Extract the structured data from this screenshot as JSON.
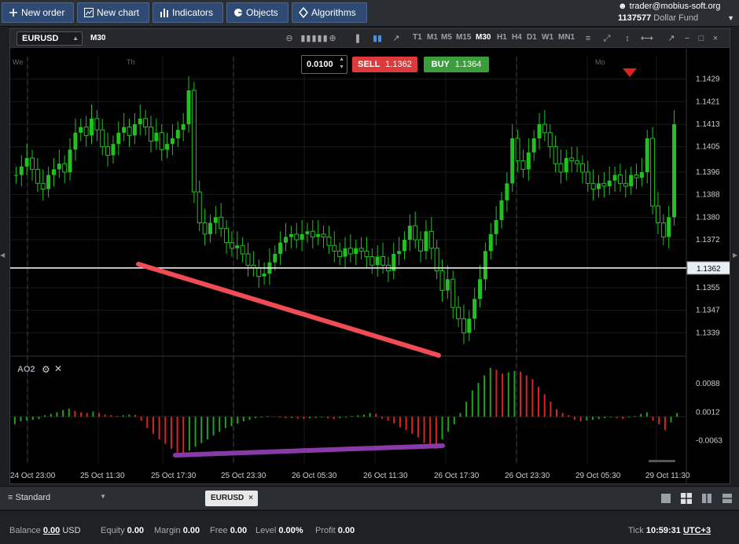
{
  "toolbar": {
    "new_order": "New order",
    "new_chart": "New chart",
    "indicators": "Indicators",
    "objects": "Objects",
    "algorithms": "Algorithms"
  },
  "account": {
    "user": "trader@mobius-soft.org",
    "number": "1137577",
    "fund": "Dollar Fund"
  },
  "chart_header": {
    "symbol": "EURUSD",
    "timeframe": "M30",
    "timeframes": [
      "T1",
      "M1",
      "M5",
      "M15",
      "M30",
      "H1",
      "H4",
      "D1",
      "W1",
      "MN1"
    ],
    "active_timeframe": "M30"
  },
  "trade": {
    "volume": "0.0100",
    "sell_label": "SELL",
    "sell_price": "1.1362",
    "buy_label": "BUY",
    "buy_price": "1.1364"
  },
  "chart_data": [
    {
      "type": "candlestick",
      "symbol": "EURUSD",
      "timeframe": "M30",
      "y_ticks": [
        "1.1429",
        "1.1421",
        "1.1413",
        "1.1405",
        "1.1396",
        "1.1388",
        "1.1380",
        "1.1372",
        "1.1362",
        "1.1355",
        "1.1347",
        "1.1339"
      ],
      "ylim": [
        1.1331,
        1.1437
      ],
      "current_price": "1.1362",
      "day_labels": [
        "We",
        "Th",
        "Mo"
      ],
      "colors": {
        "up": "#22c022",
        "down": "#22c022",
        "price_line": "#ffffff",
        "marker": "#dd2222"
      },
      "series": [
        {
          "values": [
            1.1395,
            1.1398,
            1.1401,
            1.1397,
            1.1392,
            1.139,
            1.1395,
            1.1397,
            1.1399,
            1.1396,
            1.1404,
            1.141,
            1.1412,
            1.1409,
            1.1415,
            1.1411,
            1.1405,
            1.1402,
            1.1406,
            1.141,
            1.1412,
            1.1409,
            1.1413,
            1.1415,
            1.1412,
            1.1407,
            1.141,
            1.1404,
            1.1406,
            1.1408,
            1.1411,
            1.1413,
            1.1425,
            1.1389,
            1.1378,
            1.1374,
            1.1378,
            1.138,
            1.1376,
            1.1371,
            1.1369,
            1.137,
            1.1367,
            1.1363,
            1.1362,
            1.1359,
            1.136,
            1.1364,
            1.1367,
            1.1371,
            1.1373,
            1.1374,
            1.1372,
            1.1374,
            1.1375,
            1.1373,
            1.1374,
            1.1373,
            1.137,
            1.1368,
            1.1366,
            1.1369,
            1.1367,
            1.1369,
            1.1368,
            1.1366,
            1.1363,
            1.1366,
            1.1363,
            1.1361,
            1.1367,
            1.1368,
            1.1372,
            1.1377,
            1.1372,
            1.1368,
            1.1375,
            1.1369,
            1.1361,
            1.1354,
            1.1358,
            1.1348,
            1.1344,
            1.1339,
            1.1344,
            1.1351,
            1.1358,
            1.1368,
            1.1374,
            1.1379,
            1.1386,
            1.1392,
            1.1408,
            1.14,
            1.1397,
            1.1403,
            1.1408,
            1.1413,
            1.141,
            1.1405,
            1.1399,
            1.1396,
            1.1401,
            1.14,
            1.1399,
            1.1396,
            1.1392,
            1.139,
            1.1392,
            1.1391,
            1.1393,
            1.1395,
            1.1392,
            1.1391,
            1.1395,
            1.1394,
            1.1396,
            1.1408,
            1.1384,
            1.1378,
            1.1373,
            1.138,
            1.1413
          ]
        }
      ]
    },
    {
      "type": "bar",
      "name": "AO2",
      "y_ticks": [
        "0.0088",
        "0.0012",
        "-0.0063"
      ],
      "ylim": [
        -0.0125,
        0.0155
      ],
      "colors": {
        "up": "#22a022",
        "down": "#dd2222"
      },
      "series": [
        {
          "values": [
            -0.002,
            -0.0012,
            -0.001,
            -0.0008,
            -0.0006,
            0.0004,
            0.0008,
            0.0012,
            0.0018,
            0.0022,
            0.0016,
            0.0012,
            0.001,
            0.0014,
            0.001,
            0.0006,
            0.0004,
            0.0002,
            0.0004,
            0.0006,
            0.0005,
            -0.001,
            -0.003,
            -0.0045,
            -0.006,
            -0.0072,
            -0.0085,
            -0.0095,
            -0.01,
            -0.009,
            -0.008,
            -0.007,
            -0.006,
            -0.005,
            -0.004,
            -0.003,
            -0.0025,
            -0.0018,
            -0.0012,
            -0.0008,
            -0.0004,
            -0.0002,
            0.0002,
            0.0001,
            -0.0002,
            -0.0004,
            -0.0003,
            -0.0005,
            -0.0006,
            -0.0004,
            -0.0003,
            -0.0002,
            -0.0004,
            -0.0006,
            -0.0004,
            -0.0002,
            0.0002,
            0.0004,
            0.0006,
            0.001,
            0.0008,
            -0.0005,
            -0.001,
            -0.0018,
            -0.0028,
            -0.0035,
            -0.0045,
            -0.0055,
            -0.007,
            -0.008,
            -0.0085,
            -0.006,
            -0.004,
            -0.002,
            0.001,
            0.004,
            0.007,
            0.009,
            0.011,
            0.013,
            0.0125,
            0.0115,
            0.0118,
            0.0122,
            0.012,
            0.011,
            0.01,
            0.008,
            0.006,
            0.004,
            0.002,
            0.001,
            0.0004,
            -0.0008,
            -0.0012,
            -0.001,
            -0.0008,
            -0.0006,
            -0.0004,
            -0.0002,
            -0.0004,
            -0.0006,
            -0.0002,
            0.0002,
            0.0008,
            0.0012,
            -0.001,
            -0.002,
            -0.0035,
            -0.0015,
            0.001
          ]
        }
      ]
    }
  ],
  "indicator": {
    "name": "AO2"
  },
  "time_axis": [
    "24 Oct 23:00",
    "25 Oct 11:30",
    "25 Oct 17:30",
    "25 Oct 23:30",
    "26 Oct 05:30",
    "26 Oct 11:30",
    "26 Oct 17:30",
    "26 Oct 23:30",
    "29 Oct 05:30",
    "29 Oct 11:30"
  ],
  "workspace": {
    "name": "Standard"
  },
  "open_tab": {
    "symbol": "EURUSD"
  },
  "status": {
    "balance_label": "Balance",
    "balance_value": "0.00",
    "balance_currency": "USD",
    "equity_label": "Equity",
    "equity_value": "0.00",
    "margin_label": "Margin",
    "margin_value": "0.00",
    "free_label": "Free",
    "free_value": "0.00",
    "level_label": "Level",
    "level_value": "0.00%",
    "profit_label": "Profit",
    "profit_value": "0.00",
    "tick_label": "Tick",
    "tick_time": "10:59:31",
    "timezone": "UTC+3"
  }
}
